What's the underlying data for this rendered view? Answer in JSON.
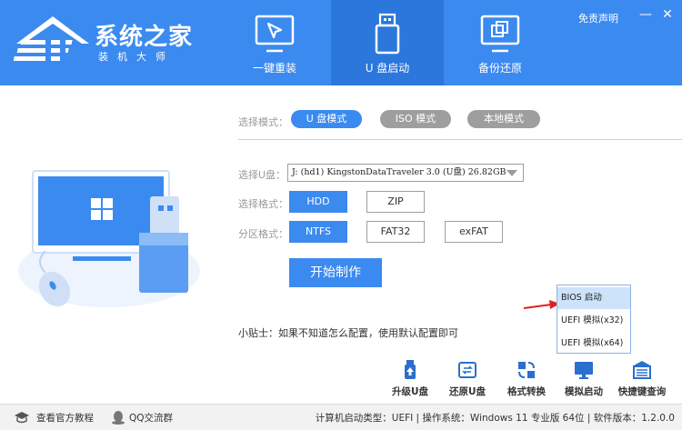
{
  "app": {
    "title": "系统之家",
    "subtitle": "装机大师",
    "disclaimer": "免责声明",
    "minimize_glyph": "—",
    "close_glyph": "✕"
  },
  "colors": {
    "accent": "#3b8af0",
    "accent_dark": "#2b77dc",
    "inactive_pill": "#9e9e9e",
    "arrow": "#e02020"
  },
  "nav": {
    "tabs": [
      {
        "label": "一键重装",
        "icon": "cursor-icon",
        "active": false
      },
      {
        "label": "U 盘启动",
        "icon": "usb-drive-icon",
        "active": true
      },
      {
        "label": "备份还原",
        "icon": "backup-copy-icon",
        "active": false
      }
    ]
  },
  "mode": {
    "label": "选择模式：",
    "options": [
      {
        "label": "U 盘模式",
        "selected": true
      },
      {
        "label": "ISO 模式",
        "selected": false
      },
      {
        "label": "本地模式",
        "selected": false
      }
    ]
  },
  "usb": {
    "label": "选择U盘：",
    "selected": "J: (hd1) KingstonDataTraveler 3.0 (U盘) 26.82GB"
  },
  "format": {
    "label": "选择格式：",
    "options": [
      {
        "label": "HDD",
        "selected": true
      },
      {
        "label": "ZIP",
        "selected": false
      }
    ]
  },
  "partition": {
    "label": "分区格式：",
    "options": [
      {
        "label": "NTFS",
        "selected": true
      },
      {
        "label": "FAT32",
        "selected": false
      },
      {
        "label": "exFAT",
        "selected": false
      }
    ]
  },
  "start_button": "开始制作",
  "tip": "小贴士：如果不知道怎么配置，使用默认配置即可",
  "boot_dropdown": {
    "items": [
      {
        "label": "BIOS 启动",
        "selected": true
      },
      {
        "label": "UEFI 模拟(x32)",
        "selected": false
      },
      {
        "label": "UEFI 模拟(x64)",
        "selected": false
      }
    ]
  },
  "tools": [
    {
      "label": "升级U盘",
      "icon": "usb-upgrade-icon"
    },
    {
      "label": "还原U盘",
      "icon": "restore-icon"
    },
    {
      "label": "格式转换",
      "icon": "convert-icon"
    },
    {
      "label": "模拟启动",
      "icon": "monitor-icon"
    },
    {
      "label": "快捷键查询",
      "icon": "keyboard-icon"
    }
  ],
  "footer": {
    "tutorial": "查看官方教程",
    "qq": "QQ交流群",
    "status": "计算机启动类型：UEFI | 操作系统：Windows 11 专业版 64位 | 软件版本：1.2.0.0"
  }
}
